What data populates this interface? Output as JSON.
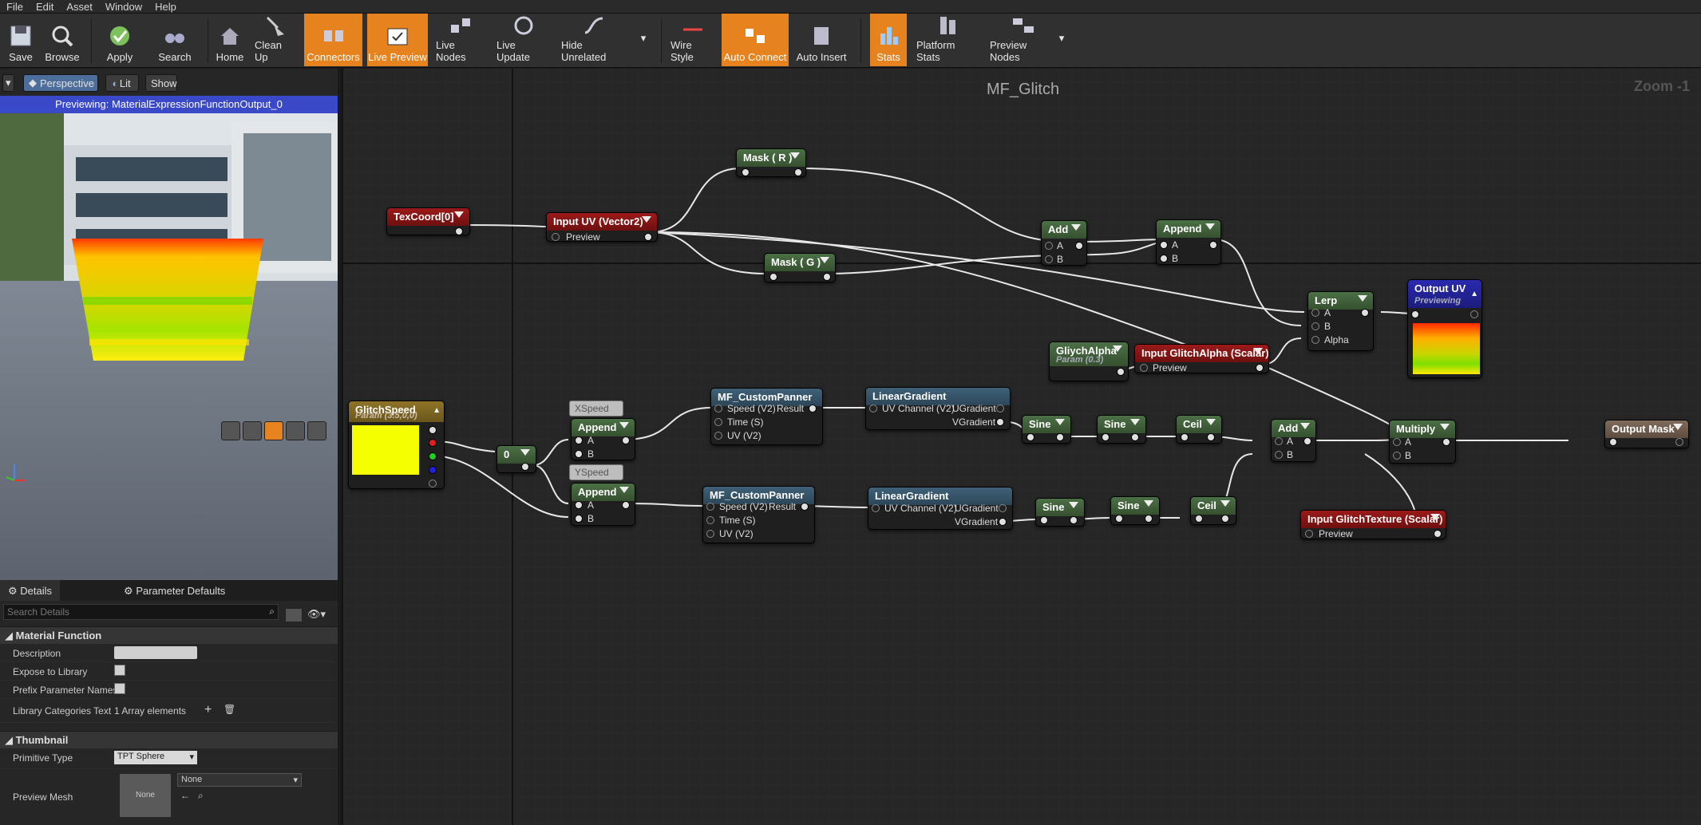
{
  "menu": [
    "File",
    "Edit",
    "Asset",
    "Window",
    "Help"
  ],
  "toolbar": {
    "save": "Save",
    "browse": "Browse",
    "apply": "Apply",
    "search": "Search",
    "home": "Home",
    "cleanup": "Clean Up",
    "connectors": "Connectors",
    "live_preview": "Live Preview",
    "live_nodes": "Live Nodes",
    "live_update": "Live Update",
    "hide_unrelated": "Hide Unrelated",
    "wire_style": "Wire Style",
    "auto_connect": "Auto Connect",
    "auto_insert": "Auto Insert",
    "stats": "Stats",
    "platform_stats": "Platform Stats",
    "preview_nodes": "Preview Nodes"
  },
  "viewport": {
    "perspective": "Perspective",
    "lit": "Lit",
    "show": "Show",
    "previewing": "Previewing: MaterialExpressionFunctionOutput_0"
  },
  "details": {
    "tab_details": "Details",
    "tab_params": "Parameter Defaults",
    "search_placeholder": "Search Details",
    "section_mf": "Material Function",
    "description": "Description",
    "expose": "Expose to Library",
    "prefix": "Prefix Parameter Names",
    "lib_cats": "Library Categories Text",
    "lib_cats_val": "1 Array elements",
    "section_thumb": "Thumbnail",
    "prim_type": "Primitive Type",
    "prim_val": "TPT Sphere",
    "preview_mesh": "Preview Mesh",
    "mesh_val": "None",
    "mesh_thumb": "None"
  },
  "graph": {
    "title": "MF_Glitch",
    "zoom": "Zoom -1",
    "texcoord": "TexCoord[0]",
    "input_uv": "Input UV (Vector2)",
    "preview": "Preview",
    "mask_r": "Mask ( R )",
    "mask_g": "Mask ( G )",
    "add": "Add",
    "append": "Append",
    "a": "A",
    "b": "B",
    "alpha": "Alpha",
    "lerp": "Lerp",
    "output_uv": "Output UV",
    "previewing": "Previewing",
    "glitch_alpha": "GliychAlpha",
    "glitch_alpha_param": "Param (0.3)",
    "input_glitch_alpha": "Input GlitchAlpha (Scalar)",
    "glitch_speed": "GlitchSpeed",
    "glitch_speed_param": "Param (3.5,0,0)",
    "zero": "0",
    "xspeed": "XSpeed",
    "yspeed": "YSpeed",
    "custom_panner": "MF_CustomPanner",
    "speed": "Speed (V2)",
    "result": "Result",
    "time": "Time (S)",
    "uv": "UV (V2)",
    "linear_gradient": "LinearGradient",
    "uv_channel": "UV Channel (V2)",
    "ugradient": "UGradient",
    "vgradient": "VGradient",
    "sine": "Sine",
    "ceil": "Ceil",
    "multiply": "Multiply",
    "output_mask": "Output Mask",
    "input_glitch_texture": "Input GlitchTexture (Scalar)"
  }
}
